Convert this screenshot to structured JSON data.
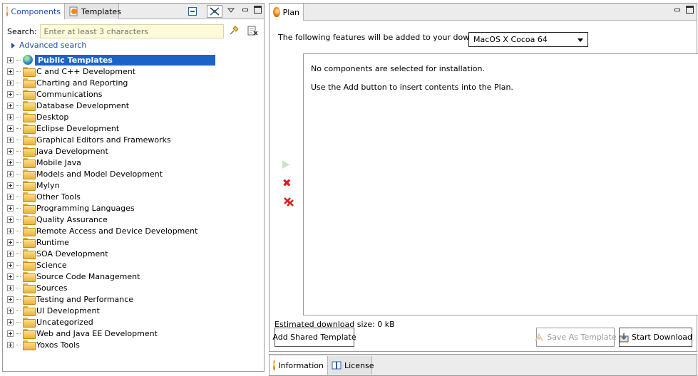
{
  "left_panel": {
    "tabs": [
      {
        "label": "Components",
        "active": true
      },
      {
        "label": "Templates",
        "active": false
      }
    ],
    "search": {
      "label": "Search:",
      "placeholder": "Enter at least 3 characters"
    },
    "advanced_search": "Advanced search",
    "tree": [
      {
        "label": "Public Templates",
        "icon": "globe-icon",
        "selected": true
      },
      {
        "label": "C and C++ Development",
        "icon": "folder-icon"
      },
      {
        "label": "Charting and Reporting",
        "icon": "folder-icon"
      },
      {
        "label": "Communications",
        "icon": "folder-icon"
      },
      {
        "label": "Database Development",
        "icon": "folder-icon"
      },
      {
        "label": "Desktop",
        "icon": "folder-icon"
      },
      {
        "label": "Eclipse Development",
        "icon": "folder-icon"
      },
      {
        "label": "Graphical Editors and Frameworks",
        "icon": "folder-icon"
      },
      {
        "label": "Java Development",
        "icon": "folder-icon"
      },
      {
        "label": "Mobile Java",
        "icon": "folder-icon"
      },
      {
        "label": "Models and Model Development",
        "icon": "folder-icon"
      },
      {
        "label": "Mylyn",
        "icon": "folder-icon"
      },
      {
        "label": "Other Tools",
        "icon": "folder-icon"
      },
      {
        "label": "Programming Languages",
        "icon": "folder-icon"
      },
      {
        "label": "Quality Assurance",
        "icon": "folder-icon"
      },
      {
        "label": "Remote Access and Device Development",
        "icon": "folder-icon"
      },
      {
        "label": "Runtime",
        "icon": "folder-icon"
      },
      {
        "label": "SOA Development",
        "icon": "folder-icon"
      },
      {
        "label": "Science",
        "icon": "folder-icon"
      },
      {
        "label": "Source Code Management",
        "icon": "folder-icon"
      },
      {
        "label": "Sources",
        "icon": "folder-icon"
      },
      {
        "label": "Testing and Performance",
        "icon": "folder-icon"
      },
      {
        "label": "UI Development",
        "icon": "folder-icon"
      },
      {
        "label": "Uncategorized",
        "icon": "folder-icon"
      },
      {
        "label": "Web and Java EE Development",
        "icon": "folder-icon"
      },
      {
        "label": "Yoxos Tools",
        "icon": "folder-icon"
      }
    ]
  },
  "plan_panel": {
    "tab_label": "Plan",
    "intro": "The following features will be added to your download for",
    "platform_select": "MacOS X Cocoa 64",
    "plan_messages": [
      "No components are selected for installation.",
      "Use the Add button to insert contents into the Plan."
    ],
    "estimated_size": "Estimated download size: 0 kB",
    "buttons": {
      "add_shared_template": "Add Shared Template",
      "save_as_template": "Save As Template",
      "start_download": "Start Download"
    }
  },
  "bottom_tabs": [
    {
      "label": "Information",
      "active": true
    },
    {
      "label": "License",
      "active": false
    }
  ],
  "colors": {
    "selection": "#1c63c7",
    "link": "#1d4fa8",
    "remove_icon": "#d61f1f"
  }
}
